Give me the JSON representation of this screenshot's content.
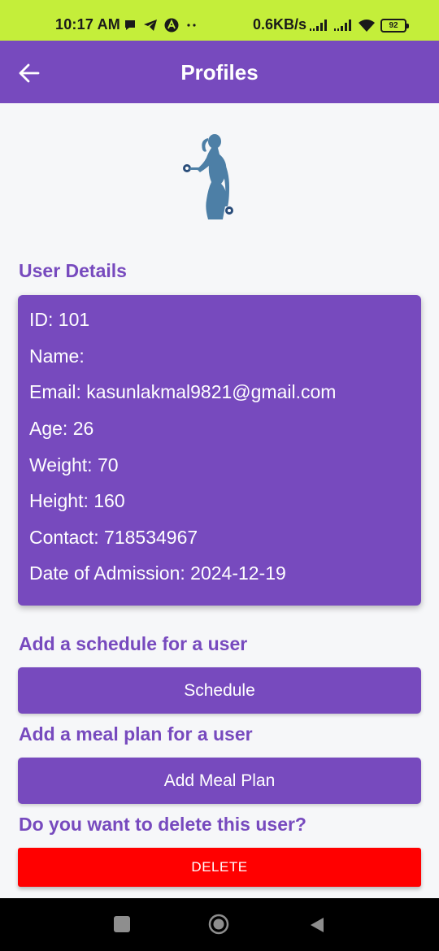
{
  "status_bar": {
    "time": "10:17 AM",
    "net_speed": "0.6KB/s",
    "battery": "92",
    "icons": [
      "chat-bubble-icon",
      "telegram-icon",
      "app-a-icon",
      "more-dots-icon",
      "signal-icon",
      "signal-icon",
      "wifi-icon",
      "battery-icon"
    ]
  },
  "app_bar": {
    "title": "Profiles",
    "back_icon": "arrow-left-icon"
  },
  "logo": {
    "icon": "fitness-woman-dumbbell-icon",
    "color": "#4d7fa6"
  },
  "user_details": {
    "heading": "User Details",
    "id": "ID: 101",
    "name": "Name:",
    "email": "Email: kasunlakmal9821@gmail.com",
    "age": "Age: 26",
    "weight": "Weight: 70",
    "height": "Height: 160",
    "contact": "Contact: 718534967",
    "admission": "Date of Admission: 2024-12-19"
  },
  "schedule_section": {
    "heading": "Add a schedule for a user",
    "button_label": "Schedule"
  },
  "meal_section": {
    "heading": "Add a meal plan for a user",
    "button_label": "Add Meal Plan"
  },
  "delete_section": {
    "heading": "Do you want to delete this user?",
    "button_label": "DELETE"
  },
  "nav_bar": {
    "icons": [
      "recent-apps-icon",
      "home-icon",
      "back-triangle-icon"
    ]
  },
  "colors": {
    "primary": "#774abe",
    "status_bar": "#c4ee3a",
    "danger": "#ff0000",
    "background": "#f6f7f9"
  }
}
